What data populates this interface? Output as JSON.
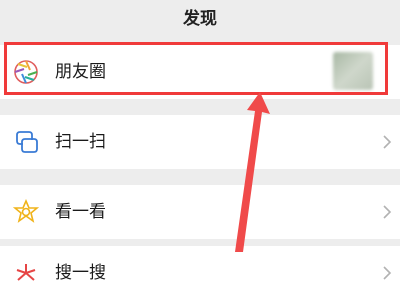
{
  "header": {
    "title": "发现"
  },
  "rows": [
    {
      "label": "朋友圈",
      "icon": "moments-aperture-icon"
    },
    {
      "label": "扫一扫",
      "icon": "scan-icon"
    },
    {
      "label": "看一看",
      "icon": "top-stories-icon"
    },
    {
      "label": "搜一搜",
      "icon": "search-sparkle-icon"
    }
  ],
  "annotation": {
    "highlight_color": "#f03a3a",
    "arrow_color": "#f04a4a"
  }
}
